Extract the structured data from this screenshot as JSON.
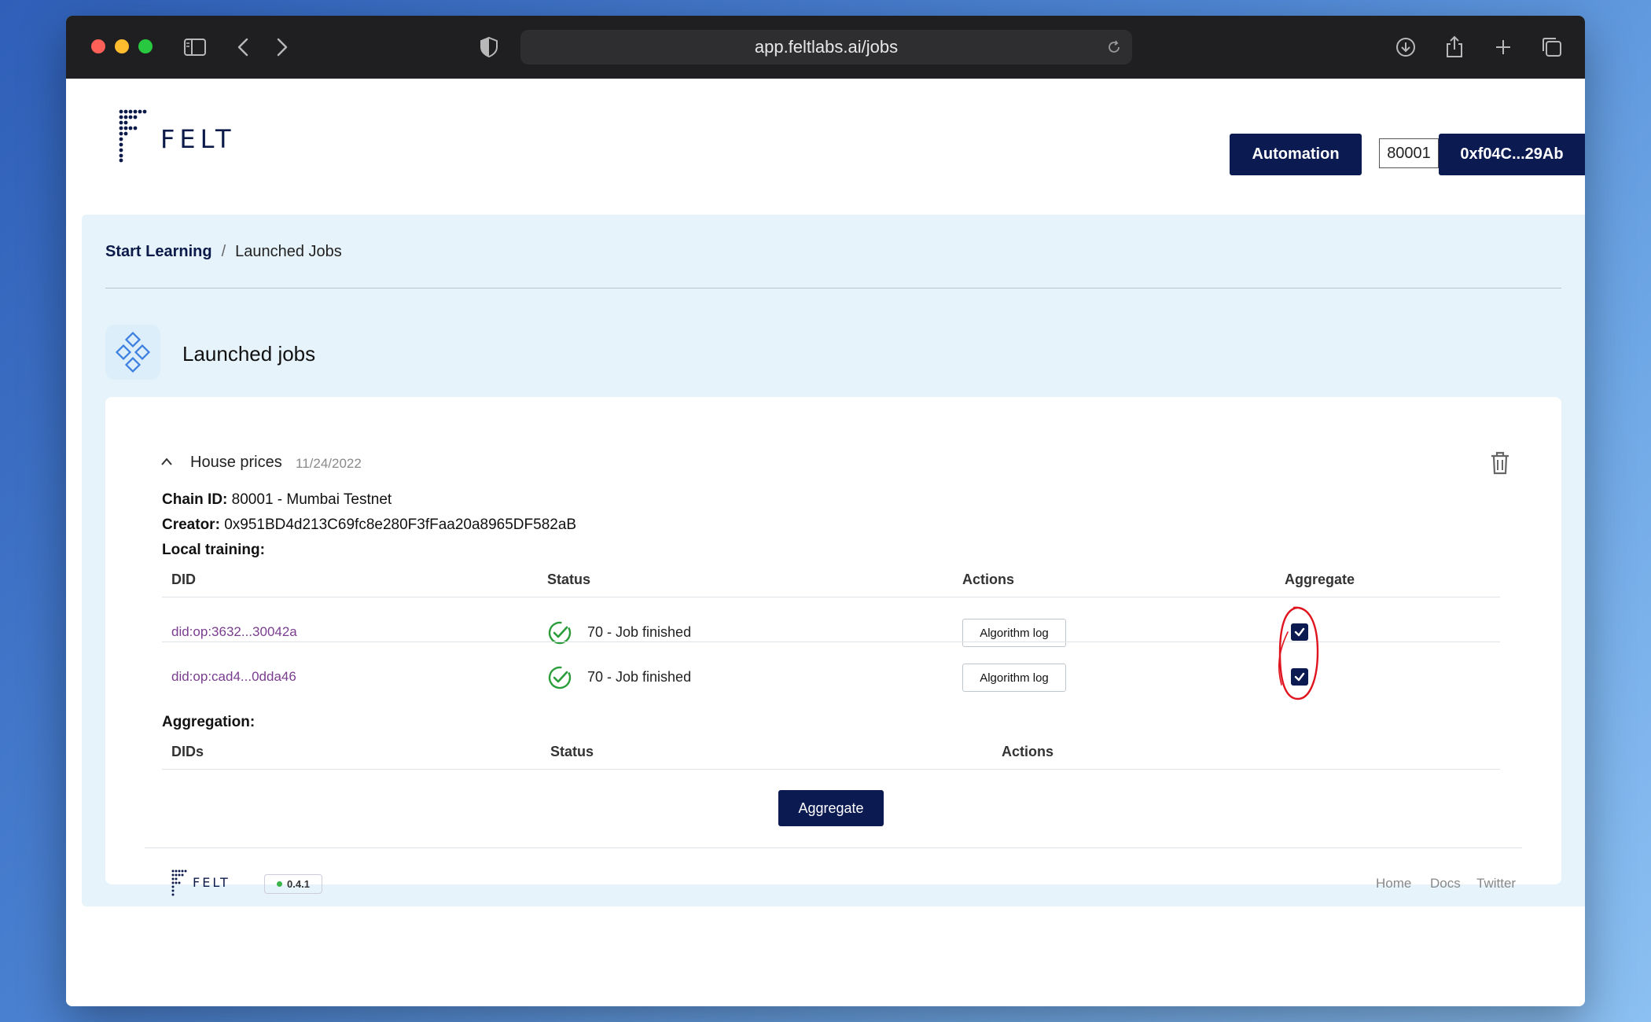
{
  "browser": {
    "url": "app.feltlabs.ai/jobs"
  },
  "header": {
    "logo_text": "FELT",
    "automation_label": "Automation",
    "chain_id": "80001",
    "wallet_label": "0xf04C...29Ab"
  },
  "breadcrumb": {
    "root": "Start Learning",
    "separator": "/",
    "current": "Launched Jobs"
  },
  "page": {
    "title": "Launched jobs"
  },
  "job": {
    "name": "House prices",
    "date": "11/24/2022",
    "chain_label": "Chain ID:",
    "chain_value": "80001 - Mumbai Testnet",
    "creator_label": "Creator:",
    "creator_value": "0x951BD4d213C69fc8e280F3fFaa20a8965DF582aB",
    "local_training_label": "Local training:",
    "local_columns": [
      "DID",
      "Status",
      "Actions",
      "Aggregate"
    ],
    "local_rows": [
      {
        "did": "did:op:3632...30042a",
        "status": "70 - Job finished",
        "action": "Algorithm log",
        "checked": true
      },
      {
        "did": "did:op:cad4...0dda46",
        "status": "70 - Job finished",
        "action": "Algorithm log",
        "checked": true
      }
    ],
    "aggregation_label": "Aggregation:",
    "aggregation_columns": [
      "DIDs",
      "Status",
      "Actions"
    ],
    "aggregate_button": "Aggregate"
  },
  "footer": {
    "logo_text": "FELT",
    "version": "0.4.1",
    "links": [
      "Home",
      "Docs",
      "Twitter"
    ]
  },
  "colors": {
    "brand_navy": "#0c1a52",
    "panel_bg": "#e6f3fb",
    "success_green": "#2a9d3a",
    "annotation_red": "#e0141e",
    "link_purple": "#7a3d8f"
  }
}
